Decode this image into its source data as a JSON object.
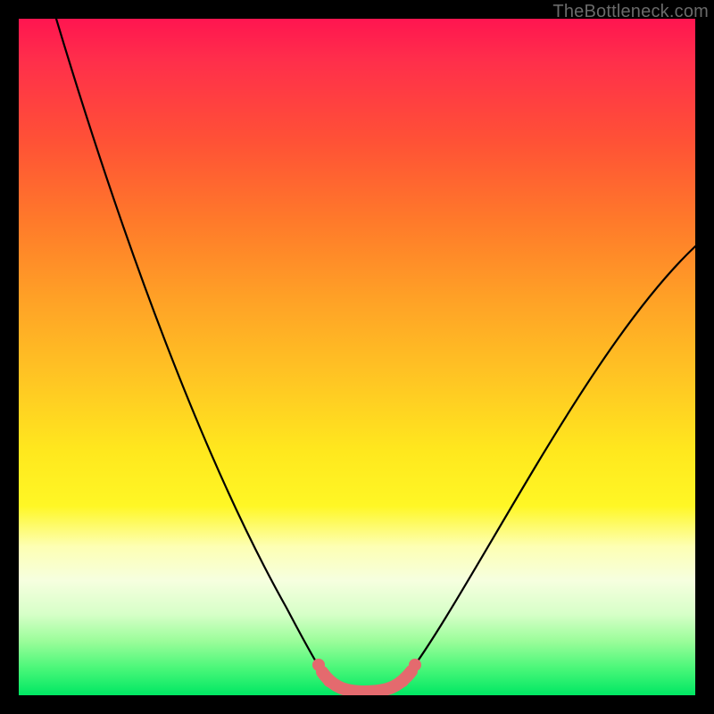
{
  "watermark": "TheBottleneck.com",
  "colors": {
    "background": "#000000",
    "curve": "#000000",
    "marker": "#e46a6e"
  },
  "chart_data": {
    "type": "line",
    "title": "",
    "xlabel": "",
    "ylabel": "",
    "xlim": [
      0,
      100
    ],
    "ylim": [
      0,
      100
    ],
    "series": [
      {
        "name": "bottleneck-curve",
        "x": [
          0,
          5,
          10,
          15,
          20,
          25,
          30,
          35,
          40,
          42,
          44,
          46,
          48,
          50,
          52,
          54,
          56,
          58,
          60,
          65,
          70,
          75,
          80,
          85,
          90,
          95,
          100
        ],
        "y": [
          100,
          92,
          82,
          72,
          62,
          51,
          40,
          28,
          15,
          10,
          6,
          3,
          1,
          0,
          0,
          1,
          3,
          6,
          10,
          19,
          28,
          36,
          43,
          49,
          55,
          60,
          64
        ]
      }
    ],
    "optimal_range_x": [
      44,
      56
    ],
    "marker_dots_x": [
      44,
      46,
      54,
      56
    ],
    "grid": false,
    "legend": false
  }
}
